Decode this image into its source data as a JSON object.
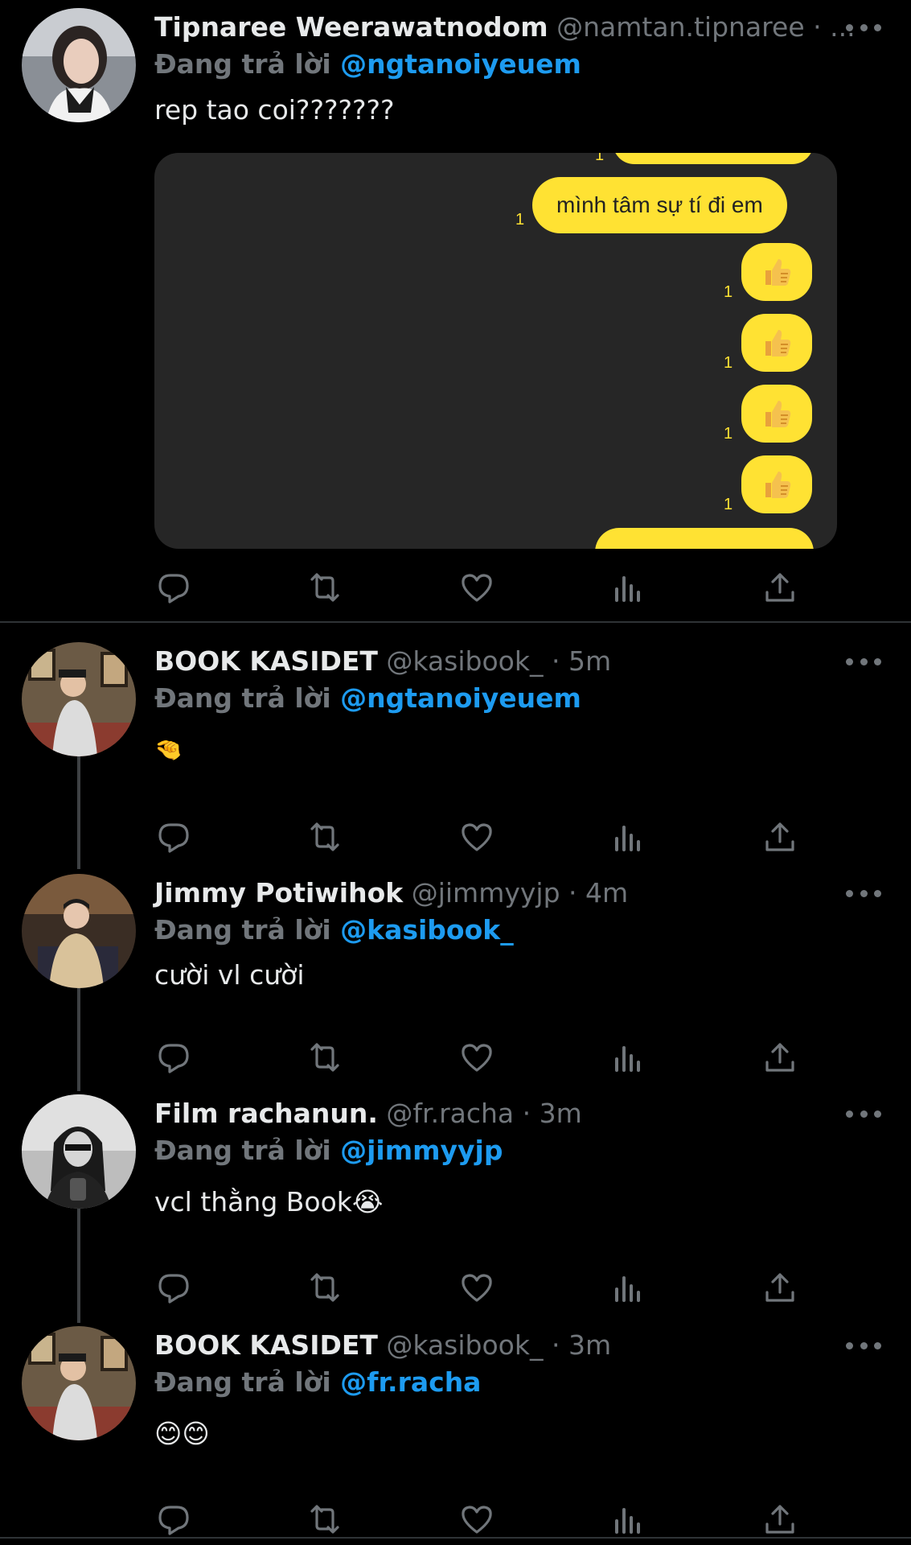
{
  "tweets": [
    {
      "name": "Tipnaree Weerawatnodom",
      "handle": "@namtan.tipnaree · ...",
      "reply_prefix": "Đang trả lời",
      "reply_to": "@ngtanoiyeuem",
      "text": "rep tao coi???????",
      "media": {
        "message_text": "mình tâm sự tí đi em",
        "read_count": "1",
        "thumbs_up_icon": "thumbs-up-emoji"
      }
    },
    {
      "name": "BOOK KASIDET",
      "handle": "@kasibook_ · 5m",
      "reply_prefix": "Đang trả lời",
      "reply_to": "@ngtanoiyeuem",
      "text": "🤏"
    },
    {
      "name": "Jimmy Potiwihok",
      "handle": "@jimmyyjp · 4m",
      "reply_prefix": "Đang trả lời",
      "reply_to": "@kasibook_",
      "text": "cười vl cười"
    },
    {
      "name": "Film rachanun.",
      "handle": "@fr.racha · 3m",
      "reply_prefix": "Đang trả lời",
      "reply_to": "@jimmyyjp",
      "text": "vcl thằng Book😭"
    },
    {
      "name": "BOOK KASIDET",
      "handle": "@kasibook_ · 3m",
      "reply_prefix": "Đang trả lời",
      "reply_to": "@fr.racha",
      "text": "😊😊"
    }
  ],
  "action_icons": [
    "reply-icon",
    "retweet-icon",
    "like-icon",
    "views-icon",
    "share-icon"
  ],
  "colors": {
    "background": "#000000",
    "text": "#e7e9ea",
    "muted": "#71767b",
    "link": "#1d9bf0",
    "chat_bubble": "#ffe233",
    "media_bg": "#262626"
  }
}
